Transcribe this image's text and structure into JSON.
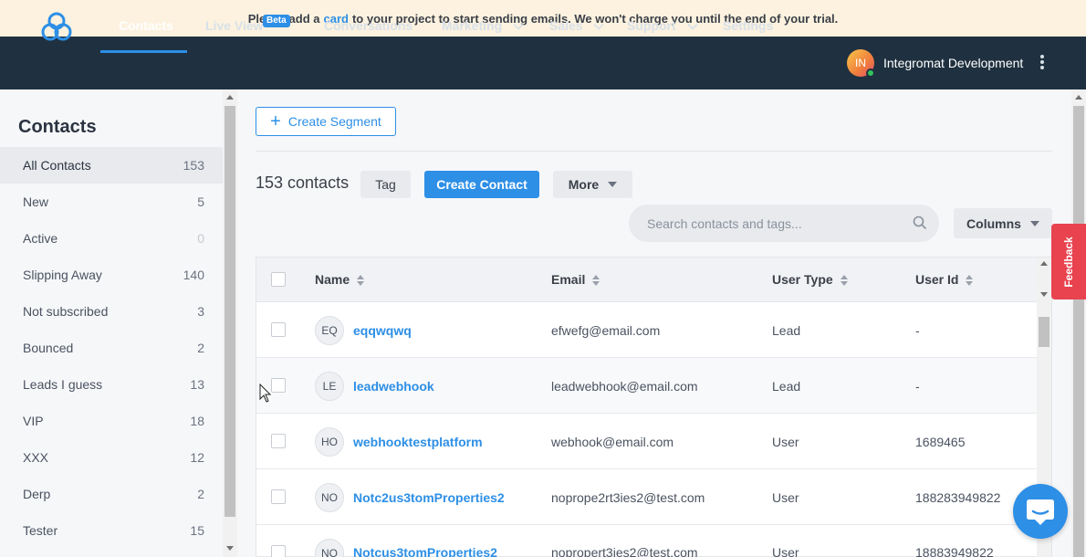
{
  "banner": {
    "text_before": "Please add a",
    "link": "card",
    "text_after": "to your project to start sending emails. We won't charge you until the end of your trial."
  },
  "nav": {
    "items": [
      {
        "label": "Contacts"
      },
      {
        "label": "Live View"
      },
      {
        "label": "Conversations"
      },
      {
        "label": "Marketing"
      },
      {
        "label": "Sales"
      },
      {
        "label": "Support"
      },
      {
        "label": "Settings"
      }
    ],
    "beta_badge": "Beta",
    "user": {
      "initials": "IN",
      "name": "Integromat Development"
    }
  },
  "sidebar": {
    "title": "Contacts",
    "items": [
      {
        "label": "All Contacts",
        "count": "153"
      },
      {
        "label": "New",
        "count": "5"
      },
      {
        "label": "Active",
        "count": "0"
      },
      {
        "label": "Slipping Away",
        "count": "140"
      },
      {
        "label": "Not subscribed",
        "count": "3"
      },
      {
        "label": "Bounced",
        "count": "2"
      },
      {
        "label": "Leads I guess",
        "count": "13"
      },
      {
        "label": "VIP",
        "count": "18"
      },
      {
        "label": "XXX",
        "count": "12"
      },
      {
        "label": "Derp",
        "count": "2"
      },
      {
        "label": "Tester",
        "count": "15"
      }
    ]
  },
  "toolbar": {
    "create_segment": "Create Segment",
    "count_label": "153 contacts",
    "tag": "Tag",
    "create_contact": "Create Contact",
    "more": "More",
    "search_placeholder": "Search contacts and tags...",
    "columns": "Columns"
  },
  "table": {
    "headers": {
      "name": "Name",
      "email": "Email",
      "user_type": "User Type",
      "user_id": "User Id"
    },
    "rows": [
      {
        "initials": "EQ",
        "name": "eqqwqwq",
        "email": "efwefg@email.com",
        "user_type": "Lead",
        "user_id": "-"
      },
      {
        "initials": "LE",
        "name": "leadwebhook",
        "email": "leadwebhook@email.com",
        "user_type": "Lead",
        "user_id": "-"
      },
      {
        "initials": "HO",
        "name": "webhooktestplatform",
        "email": "webhook@email.com",
        "user_type": "User",
        "user_id": "1689465"
      },
      {
        "initials": "NO",
        "name": "Notc2us3tomProperties2",
        "email": "noprope2rt3ies2@test.com",
        "user_type": "User",
        "user_id": "188283949822"
      },
      {
        "initials": "NO",
        "name": "Notcus3tomProperties2",
        "email": "nopropert3ies2@test.com",
        "user_type": "User",
        "user_id": "18883949822"
      }
    ]
  },
  "feedback_label": "Feedback",
  "colors": {
    "accent": "#2d8fe6",
    "nav_bg": "#1f3140",
    "banner_bg": "#fcf2df",
    "feedback": "#e8434f"
  }
}
